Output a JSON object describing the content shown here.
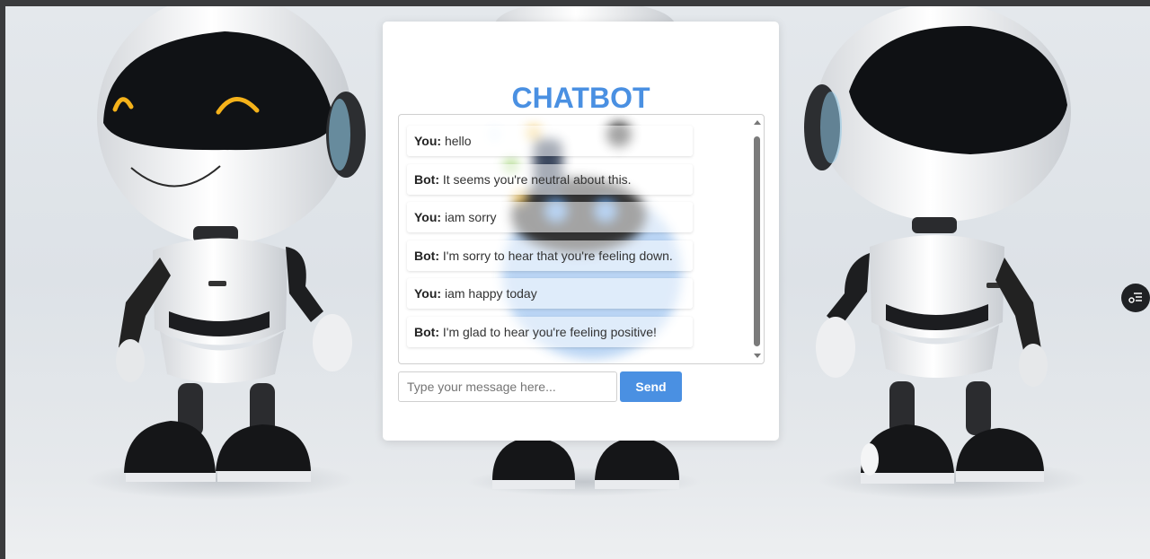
{
  "chat": {
    "title": "CHATBOT",
    "messages": [
      {
        "sender": "You:",
        "text": "hello"
      },
      {
        "sender": "Bot:",
        "text": "It seems you're neutral about this."
      },
      {
        "sender": "You:",
        "text": "iam sorry"
      },
      {
        "sender": "Bot:",
        "text": "I'm sorry to hear that you're feeling down."
      },
      {
        "sender": "You:",
        "text": "iam happy today"
      },
      {
        "sender": "Bot:",
        "text": "I'm glad to hear you're feeling positive!"
      }
    ],
    "input_placeholder": "Type your message here...",
    "send_label": "Send"
  },
  "icons": {
    "floating_button": "list-settings-icon",
    "scroll_up": "scroll-up-arrow",
    "scroll_down": "scroll-down-arrow"
  },
  "colors": {
    "accent": "#4a90e2",
    "background": "#e2e6ea",
    "card": "#ffffff"
  }
}
